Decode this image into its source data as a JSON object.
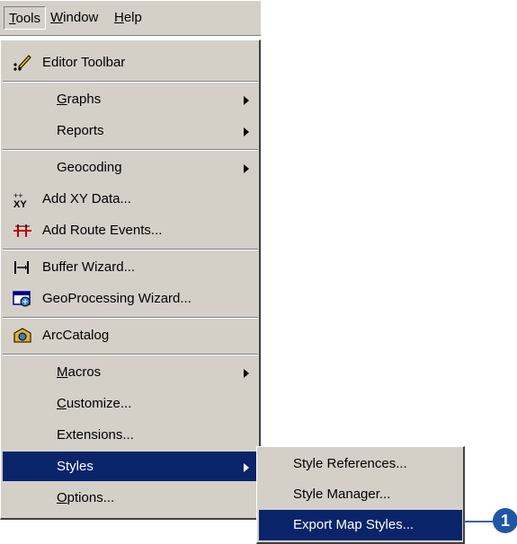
{
  "menubar": {
    "tools_prefix": "T",
    "tools_rest": "ools",
    "window_prefix": "W",
    "window_rest": "indow",
    "help_prefix": "H",
    "help_rest": "elp"
  },
  "tools_menu": {
    "items": {
      "editor_toolbar": "Editor Toolbar",
      "graphs_prefix": "G",
      "graphs_rest": "raphs",
      "reports": "Reports",
      "geocoding": "Geocoding",
      "add_xy_data": "Add XY Data...",
      "add_route_events": "Add Route Events...",
      "buffer_wizard": "Buffer Wizard...",
      "geoprocessing_wizard": "GeoProcessing Wizard...",
      "arccatalog": "ArcCatalog",
      "macros_prefix": "M",
      "macros_rest": "acros",
      "customize_prefix": "C",
      "customize_rest": "ustomize...",
      "extensions": "Extensions...",
      "styles": "Styles",
      "options_prefix": "O",
      "options_rest": "ptions..."
    }
  },
  "styles_submenu": {
    "items": {
      "style_references": "Style References...",
      "style_manager": "Style Manager...",
      "export_map_styles": "Export Map Styles..."
    }
  },
  "callout": {
    "number": "1"
  },
  "colors": {
    "menu_bg": "#d4d0c8",
    "highlight": "#0a246a",
    "callout": "#1f57a8"
  },
  "icons": [
    "editor-toolbar-icon",
    "add-xy-data-icon",
    "add-route-events-icon",
    "buffer-wizard-icon",
    "geoprocessing-wizard-icon",
    "arccatalog-icon",
    "submenu-arrow-icon"
  ]
}
